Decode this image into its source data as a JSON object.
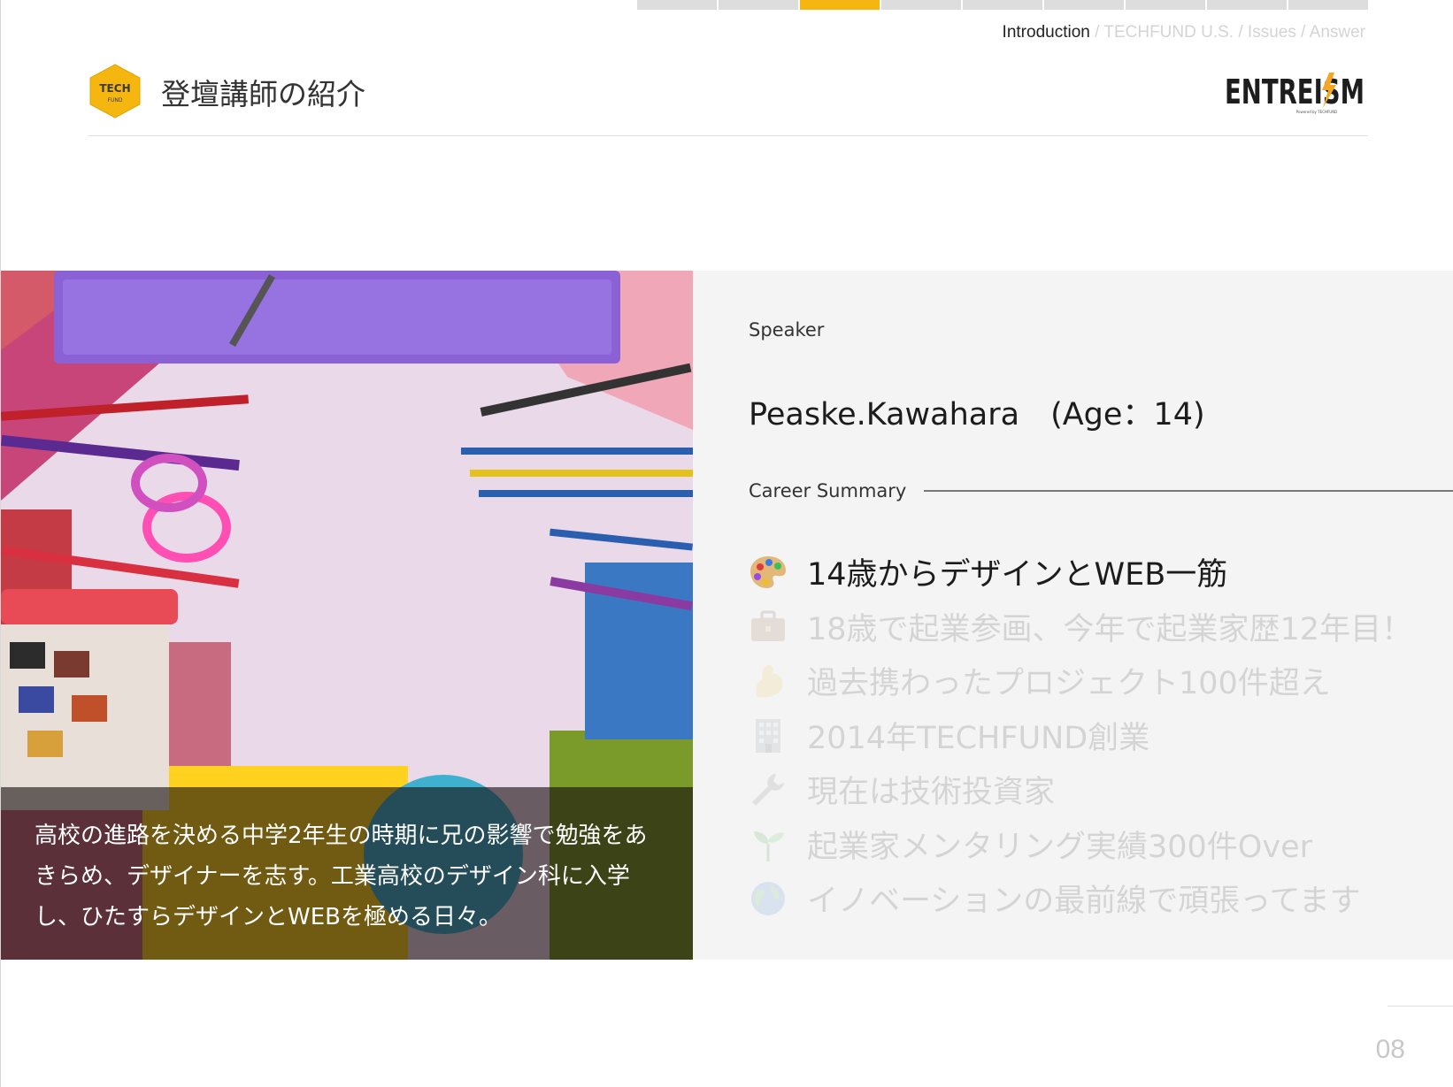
{
  "progress": {
    "segments": 9,
    "active_index": 2,
    "active_color": "#f5b70f"
  },
  "breadcrumb": {
    "items": [
      "Introduction",
      "TECHFUND U.S.",
      "Issues",
      "Answer"
    ],
    "separator": " / ",
    "current_index": 0
  },
  "header": {
    "logo_top": "TECH",
    "logo_bottom": "FUND",
    "title": "登壇講師の紹介",
    "brand": "ENTREISM",
    "brand_sub": "Powered by TECHFUND"
  },
  "photo": {
    "caption": "高校の進路を決める中学2年生の時期に兄の影響で勉強をあきらめ、デザイナーを志す。工業高校のデザイン科に入学し、ひたすらデザインとWEBを極める日々。"
  },
  "speaker": {
    "label": "Speaker",
    "name": "Peaske.Kawahara　(Age：14)"
  },
  "career": {
    "label": "Career Summary",
    "items": [
      {
        "icon": "palette-icon",
        "text": "14歳からデザインとWEB一筋",
        "highlighted": true
      },
      {
        "icon": "briefcase-icon",
        "text": "18歳で起業参画、今年で起業家歴12年目！",
        "highlighted": false
      },
      {
        "icon": "flexed-biceps-icon",
        "text": "過去携わったプロジェクト100件超え",
        "highlighted": false
      },
      {
        "icon": "office-building-icon",
        "text": "2014年TECHFUND創業",
        "highlighted": false
      },
      {
        "icon": "wrench-icon",
        "text": "現在は技術投資家",
        "highlighted": false
      },
      {
        "icon": "seedling-icon",
        "text": "起業家メンタリング実績300件Over",
        "highlighted": false
      },
      {
        "icon": "globe-icon",
        "text": "イノベーションの最前線で頑張ってます",
        "highlighted": false
      }
    ]
  },
  "page_number": "08"
}
